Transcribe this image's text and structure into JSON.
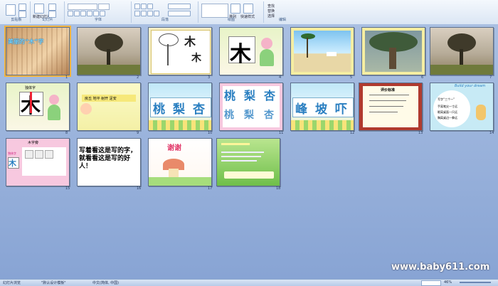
{
  "ribbon": {
    "groups": [
      {
        "label": "剪贴板"
      },
      {
        "label": "幻灯片"
      },
      {
        "label": "字体"
      },
      {
        "label": "段落"
      },
      {
        "label": "绘图"
      },
      {
        "label": "编辑"
      }
    ],
    "new_slide_label": "新建幻灯片",
    "find_label": "查找",
    "replace_label": "替换",
    "select_label": "选择",
    "arrange_label": "排列",
    "quick_styles_label": "快速样式"
  },
  "slides": [
    {
      "num": "1",
      "title": "美丽的“木”字"
    },
    {
      "num": "2"
    },
    {
      "num": "3"
    },
    {
      "num": "4",
      "char": "木"
    },
    {
      "num": "5"
    },
    {
      "num": "6"
    },
    {
      "num": "7"
    },
    {
      "num": "8",
      "heading": "独体字",
      "char": "木"
    },
    {
      "num": "9",
      "text": "房丘  地平  射开  足安"
    },
    {
      "num": "10",
      "chars": [
        "桃",
        "梨",
        "杏"
      ]
    },
    {
      "num": "11",
      "chars": [
        "桃",
        "梨",
        "杏"
      ]
    },
    {
      "num": "12",
      "chars": [
        "峰",
        "坡",
        "吓"
      ]
    },
    {
      "num": "13",
      "title": "评价标准"
    },
    {
      "num": "14",
      "title": "Build your dream",
      "lines": [
        "写字“三个一”",
        "手离笔尖一寸远",
        "眼离桌面一尺远",
        "胸离桌边一拳远"
      ]
    },
    {
      "num": "15",
      "heading": "木字旁",
      "sub": "独体字",
      "char": "木"
    },
    {
      "num": "16",
      "text": "写着看这是写的字，就看看这是写的好人！"
    },
    {
      "num": "17",
      "title": "谢谢"
    },
    {
      "num": "18"
    }
  ],
  "status": {
    "slide_info": "幻灯片浏览",
    "theme": "\"默认设计模板\"",
    "language": "中文(简体, 中国)",
    "zoom": "46%"
  },
  "watermark": "www.baby611.com",
  "colors": {
    "workspace": "#9bb3d9",
    "selection": "#f2b33d",
    "ribbon": "#dbe6f4"
  }
}
